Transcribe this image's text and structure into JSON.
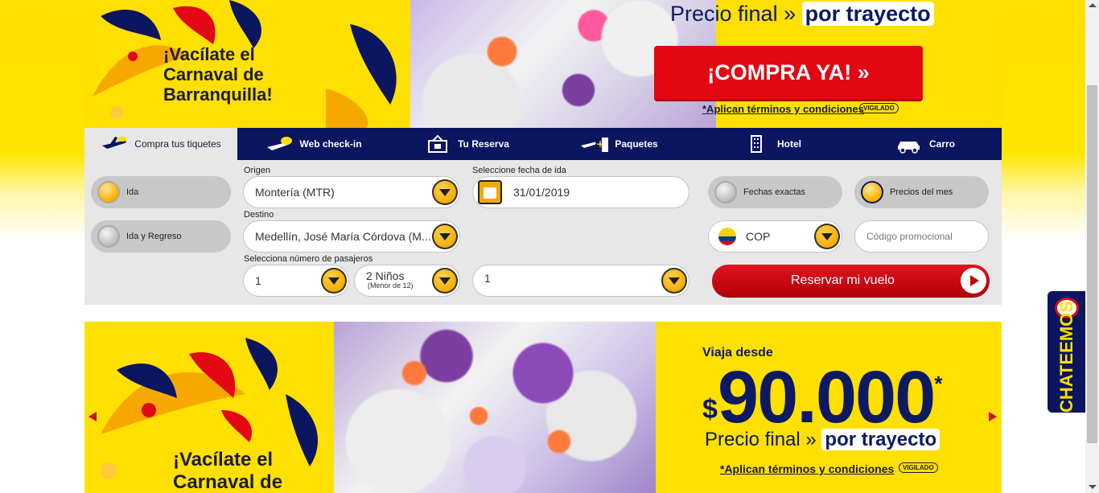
{
  "top_banner": {
    "slogan_line1": "¡Vacílate el",
    "slogan_line2_a": "Carnaval",
    "slogan_line2_b": " de",
    "slogan_line3": "Barranquilla!",
    "price_final": "Precio final » ",
    "per_leg": "por trayecto",
    "buy_label": "¡COMPRA YA!  »",
    "terms": "*Aplican términos y condiciones",
    "vigilado": "VIGILADO"
  },
  "tabs": [
    {
      "label": "Compra tus tiquetes",
      "icon": "plane-icon"
    },
    {
      "label": "Web check-in",
      "icon": "plane-cloud-icon"
    },
    {
      "label": "Tu Reserva",
      "icon": "booking-icon"
    },
    {
      "label": "Paquetes",
      "icon": "plane-hotel-icon"
    },
    {
      "label": "Hotel",
      "icon": "building-icon"
    },
    {
      "label": "Carro",
      "icon": "car-icon"
    }
  ],
  "booking": {
    "trip_one_way": "Ida",
    "trip_round": "Ida y Regreso",
    "origin_label": "Origen",
    "origin_value": "Montería (MTR)",
    "destination_label": "Destino",
    "destination_value": "Medellín, José María Córdova (M...",
    "date_label": "Seleccione fecha de ida",
    "date_value": "31/01/2019",
    "exact_dates": "Fechas exactas",
    "month_prices": "Precios del mes",
    "currency": "COP",
    "promo_placeholder": "Código promocional",
    "passengers_label": "Selecciona número de pasajeros",
    "adults": "1",
    "kids": "2 Niños",
    "kids_note": "(Menor de 12)",
    "infants": "1",
    "reserve_label": "Reservar mi vuelo"
  },
  "hero": {
    "from": "Viaja desde",
    "currency_symbol": "$",
    "price": "90.000",
    "asterisk": "*",
    "price_final": "Precio final » ",
    "per_leg": "por trayecto",
    "terms": "*Aplican términos y condiciones",
    "vigilado": "VIGILADO",
    "slogan_line1": "¡Vacílate el",
    "slogan_line2": "Carnaval de"
  },
  "chat": {
    "label": "CHATEEMOS"
  },
  "colors": {
    "brand_yellow": "#ffe000",
    "brand_navy": "#0b1560",
    "brand_red": "#e30613"
  }
}
